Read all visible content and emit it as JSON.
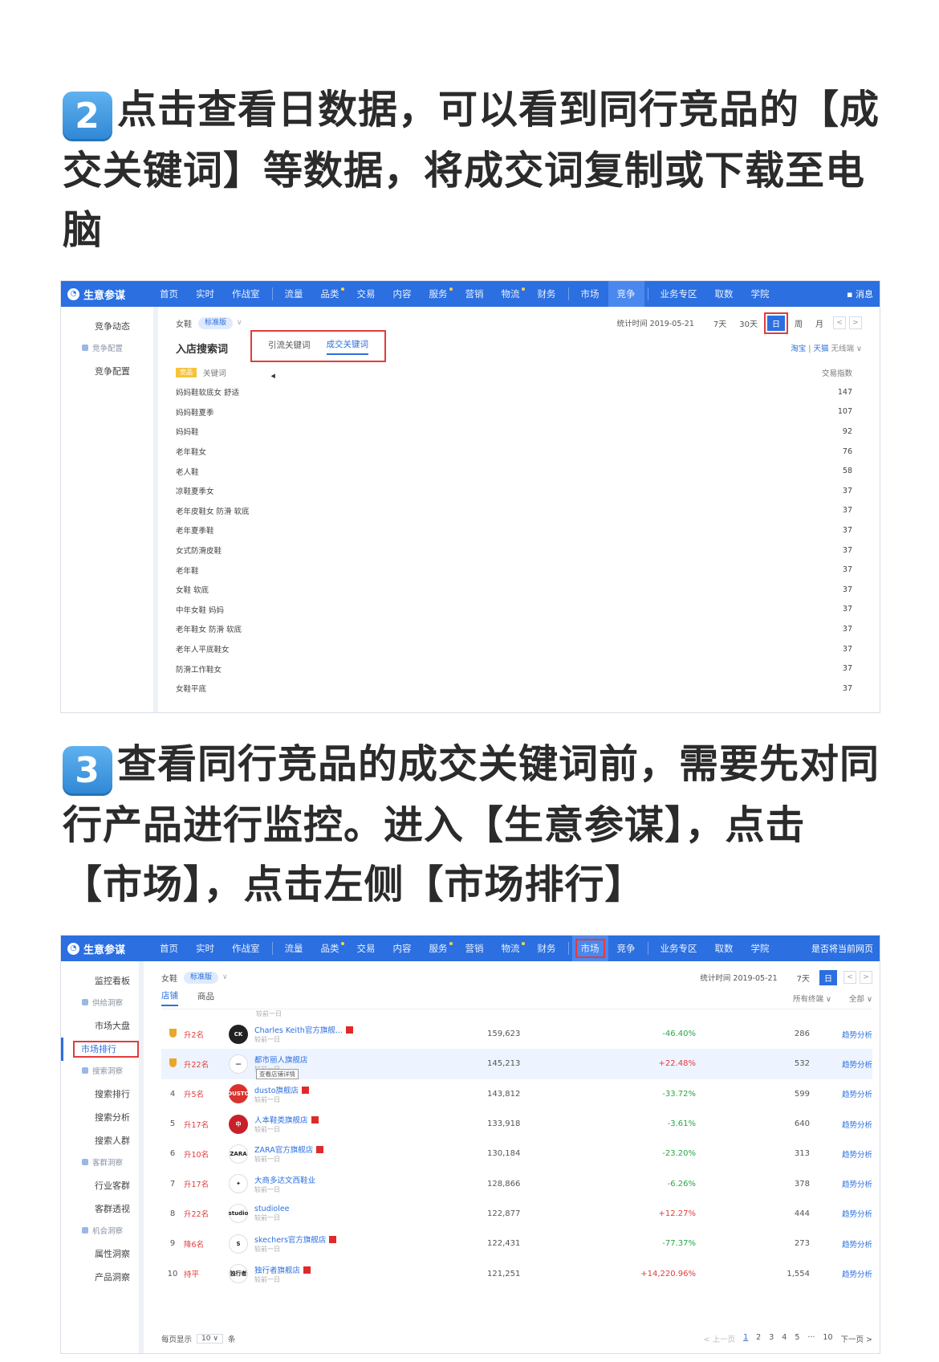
{
  "step2": {
    "badge": "2",
    "text": "点击查看日数据，可以看到同行竞品的【成交关键词】等数据，将成交词复制或下载至电脑"
  },
  "step3": {
    "badge": "3",
    "text": "查看同行竞品的成交关键词前，需要先对同行产品进行监控。进入【生意参谋】，点击【市场】，点击左侧【市场排行】"
  },
  "colors": {
    "nav_blue": "#2b6fe0",
    "highlight_red": "#e23c3c",
    "up_red": "#e23c3c",
    "down_green": "#28a745"
  },
  "shot1": {
    "logo": "生意参谋",
    "nav": [
      "首页",
      "实时",
      "作战室",
      "流量",
      "品类",
      "交易",
      "内容",
      "服务",
      "营销",
      "物流",
      "财务",
      "市场",
      "竞争",
      "业务专区",
      "取数",
      "学院"
    ],
    "nav_right": "消息",
    "sidebar": [
      "竞争动态",
      "竞争配置",
      "竞争配置"
    ],
    "category": "女鞋",
    "edition": "标准版",
    "stat_time": "统计时间 2019-05-21",
    "periods": [
      "7天",
      "30天",
      "日",
      "周",
      "月"
    ],
    "section_title": "入店搜索词",
    "tabs": [
      "引流关键词",
      "成交关键词"
    ],
    "source": {
      "a": "淘宝",
      "b": "天猫",
      "c": "无线端"
    },
    "head": {
      "badge": "竞品",
      "col1": "关键词",
      "col2": "交易指数"
    },
    "keywords": [
      {
        "kw": "妈妈鞋软底女 舒适",
        "v": "147"
      },
      {
        "kw": "妈妈鞋夏季",
        "v": "107"
      },
      {
        "kw": "妈妈鞋",
        "v": "92"
      },
      {
        "kw": "老年鞋女",
        "v": "76"
      },
      {
        "kw": "老人鞋",
        "v": "58"
      },
      {
        "kw": "凉鞋夏季女",
        "v": "37"
      },
      {
        "kw": "老年皮鞋女 防滑 软底",
        "v": "37"
      },
      {
        "kw": "老年夏季鞋",
        "v": "37"
      },
      {
        "kw": "女式防滑皮鞋",
        "v": "37"
      },
      {
        "kw": "老年鞋",
        "v": "37"
      },
      {
        "kw": "女鞋 软底",
        "v": "37"
      },
      {
        "kw": "中年女鞋 妈妈",
        "v": "37"
      },
      {
        "kw": "老年鞋女 防滑 软底",
        "v": "37"
      },
      {
        "kw": "老年人平底鞋女",
        "v": "37"
      },
      {
        "kw": "防滑工作鞋女",
        "v": "37"
      },
      {
        "kw": "女鞋平底",
        "v": "37"
      }
    ]
  },
  "shot2": {
    "logo": "生意参谋",
    "nav": [
      "首页",
      "实时",
      "作战室",
      "流量",
      "品类",
      "交易",
      "内容",
      "服务",
      "营销",
      "物流",
      "财务",
      "市场",
      "竞争",
      "业务专区",
      "取数",
      "学院"
    ],
    "nav_right": "是否将当前网页",
    "sidebar": [
      {
        "type": "item",
        "label": "监控看板"
      },
      {
        "type": "group",
        "label": "供给洞察"
      },
      {
        "type": "item",
        "label": "市场大盘"
      },
      {
        "type": "selected",
        "label": "市场排行"
      },
      {
        "type": "group",
        "label": "搜索洞察"
      },
      {
        "type": "item",
        "label": "搜索排行"
      },
      {
        "type": "item",
        "label": "搜索分析"
      },
      {
        "type": "item",
        "label": "搜索人群"
      },
      {
        "type": "group",
        "label": "客群洞察"
      },
      {
        "type": "item",
        "label": "行业客群"
      },
      {
        "type": "item",
        "label": "客群透视"
      },
      {
        "type": "group",
        "label": "机会洞察"
      },
      {
        "type": "item",
        "label": "属性洞察"
      },
      {
        "type": "item",
        "label": "产品洞察"
      }
    ],
    "category": "女鞋",
    "edition": "标准版",
    "stat_time": "统计时间 2019-05-21",
    "periods": [
      "7天",
      "日"
    ],
    "tabs": [
      "店铺",
      "商品"
    ],
    "filters": [
      "所有终端",
      "全部"
    ],
    "prev_label": "较前一日",
    "tooltip": "查看店铺详情",
    "link_label": "趋势分析",
    "rows": [
      {
        "rank": "",
        "medal": true,
        "chg": "升2名",
        "logo": "CK",
        "logo_color": "#222222",
        "name": "Charles Keith官方旗舰...",
        "tmall": true,
        "sub": "较前一日",
        "idx": "159,623",
        "pct": "-46.40%",
        "dir": "down",
        "num": "286"
      },
      {
        "rank": "",
        "medal": true,
        "chg": "升22名",
        "logo": "—",
        "logo_color": "#ffffff",
        "name": "都市丽人旗舰店",
        "tmall": false,
        "sub": "较前一日",
        "idx": "145,213",
        "pct": "+22.48%",
        "dir": "up",
        "num": "532",
        "highlight": true,
        "tip": true
      },
      {
        "rank": "4",
        "medal": false,
        "chg": "升5名",
        "logo": "DUSTO",
        "logo_color": "#d9322e",
        "name": "dusto旗舰店",
        "tmall": true,
        "sub": "较前一日",
        "idx": "143,812",
        "pct": "-33.72%",
        "dir": "down",
        "num": "599"
      },
      {
        "rank": "5",
        "medal": false,
        "chg": "升17名",
        "logo": "中",
        "logo_color": "#c8202a",
        "name": "人本鞋类旗舰店",
        "tmall": true,
        "sub": "较前一日",
        "idx": "133,918",
        "pct": "-3.61%",
        "dir": "down",
        "num": "640"
      },
      {
        "rank": "6",
        "medal": false,
        "chg": "升10名",
        "logo": "ZARA",
        "logo_color": "#ffffff",
        "name": "ZARA官方旗舰店",
        "tmall": true,
        "sub": "较前一日",
        "idx": "130,184",
        "pct": "-23.20%",
        "dir": "down",
        "num": "313"
      },
      {
        "rank": "7",
        "medal": false,
        "chg": "升17名",
        "logo": "✦",
        "logo_color": "#ffffff",
        "name": "大商多达文西鞋业",
        "tmall": false,
        "sub": "较前一日",
        "idx": "128,866",
        "pct": "-6.26%",
        "dir": "down",
        "num": "378"
      },
      {
        "rank": "8",
        "medal": false,
        "chg": "升22名",
        "logo": "studio",
        "logo_color": "#ffffff",
        "name": "studiolee",
        "tmall": false,
        "sub": "较前一日",
        "idx": "122,877",
        "pct": "+12.27%",
        "dir": "up",
        "num": "444"
      },
      {
        "rank": "9",
        "medal": false,
        "chg": "降6名",
        "logo": "S",
        "logo_color": "#ffffff",
        "name": "skechers官方旗舰店",
        "tmall": true,
        "sub": "较前一日",
        "idx": "122,431",
        "pct": "-77.37%",
        "dir": "down",
        "num": "273"
      },
      {
        "rank": "10",
        "medal": false,
        "chg": "持平",
        "logo": "独行者",
        "logo_color": "#ffffff",
        "name": "独行者旗舰店",
        "tmall": true,
        "sub": "较前一日",
        "idx": "121,251",
        "pct": "+14,220.96%",
        "dir": "up",
        "num": "1,554"
      }
    ],
    "pager": {
      "per_page_label": "每页显示",
      "per_page": "10",
      "unit": "条",
      "prev": "< 上一页",
      "pages": [
        "1",
        "2",
        "3",
        "4",
        "5",
        "···",
        "10"
      ],
      "next": "下一页 >"
    }
  }
}
